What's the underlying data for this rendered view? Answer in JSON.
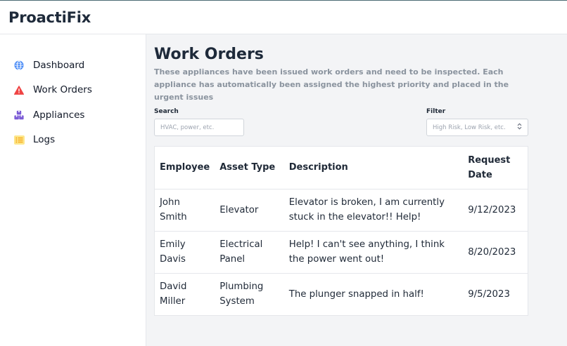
{
  "app": {
    "name": "ProactiFix"
  },
  "sidebar": {
    "items": [
      {
        "label": "Dashboard",
        "icon": "globe-icon"
      },
      {
        "label": "Work Orders",
        "icon": "warning-icon"
      },
      {
        "label": "Appliances",
        "icon": "boxes-icon"
      },
      {
        "label": "Logs",
        "icon": "list-icon"
      }
    ]
  },
  "page": {
    "title": "Work Orders",
    "subtitle": "These appliances have been issued work orders and need to be inspected. Each appliance has automatically been assigned the highest priority and placed in the urgent issues"
  },
  "search": {
    "label": "Search",
    "placeholder": "HVAC, power, etc."
  },
  "filter": {
    "label": "Filter",
    "placeholder": "High Risk, Low Risk, etc."
  },
  "table": {
    "headers": [
      "Employee",
      "Asset Type",
      "Description",
      "Request Date"
    ],
    "rows": [
      [
        "John Smith",
        "Elevator",
        "Elevator is broken, I am currently stuck in the elevator!! Help!",
        "9/12/2023"
      ],
      [
        "Emily Davis",
        "Electrical Panel",
        "Help! I can't see anything, I think the power went out!",
        "8/20/2023"
      ],
      [
        "David Miller",
        "Plumbing System",
        "The plunger snapped in half!",
        "9/5/2023"
      ]
    ]
  },
  "colors": {
    "globe": "#3b82f6",
    "warning": "#ef4444",
    "boxes": "#7c5cd6",
    "list": "#f59e0b",
    "brand": "#1e2a3a"
  }
}
